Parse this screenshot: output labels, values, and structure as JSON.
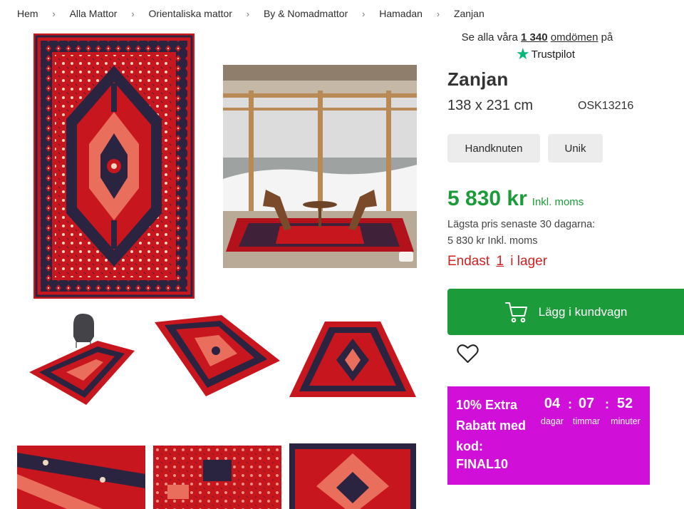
{
  "breadcrumb": {
    "items": [
      "Hem",
      "Alla Mattor",
      "Orientaliska mattor",
      "By & Nomadmattor",
      "Hamadan",
      "Zanjan"
    ]
  },
  "reviews": {
    "prefix": "Se alla våra",
    "count": "1 340",
    "word": "omdömen",
    "suffix": "på",
    "provider": "Trustpilot"
  },
  "product": {
    "title": "Zanjan",
    "size": "138 x 231 cm",
    "sku": "OSK13216",
    "tags": [
      "Handknuten",
      "Unik"
    ],
    "price": "5 830 kr",
    "vat_label": "Inkl. moms",
    "lowest_price_label": "Lägsta pris senaste 30 dagarna:",
    "lowest_price_value": "5 830 kr Inkl. moms",
    "stock_prefix": "Endast",
    "stock_count": "1",
    "stock_suffix": "i lager"
  },
  "cart": {
    "label": "Lägg i kundvagn"
  },
  "promo": {
    "text": "10% Extra Rabatt med kod:",
    "code": "FINAL10",
    "countdown": {
      "days": "04",
      "days_label": "dagar",
      "hours": "07",
      "hours_label": "timmar",
      "minutes": "52",
      "minutes_label": "minuter"
    }
  },
  "colors": {
    "green": "#1c9b3a",
    "red_stock": "#d32020",
    "promo_bg": "#d010d8",
    "trustpilot": "#00b67a",
    "rug_red": "#c8161e",
    "rug_navy": "#2a2440",
    "rug_salmon": "#e96e5c"
  },
  "icons": {
    "breadcrumb_separator": "chevron-right-icon",
    "cart": "shopping-cart-icon",
    "wishlist": "heart-icon",
    "rating": "trustpilot-star-icon"
  }
}
